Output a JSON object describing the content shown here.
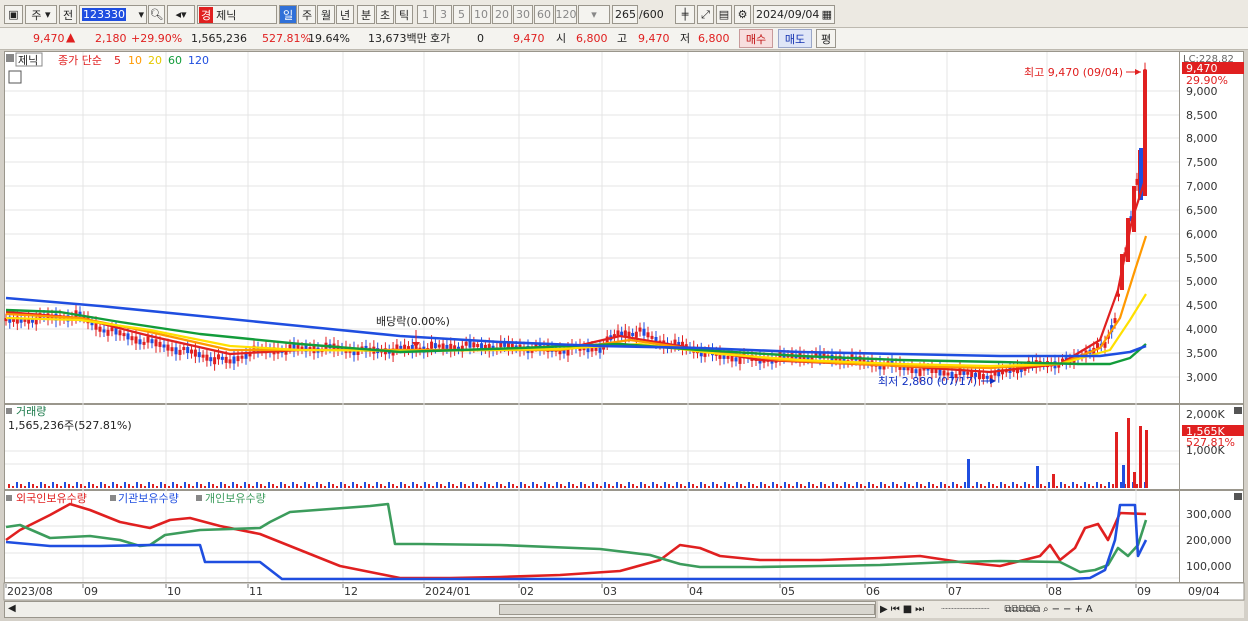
{
  "toolbar": {
    "market": "주",
    "kind": "전",
    "code": "123330",
    "badge": "경",
    "name": "제닉",
    "periods": [
      "일",
      "주",
      "월",
      "년",
      "분",
      "초",
      "틱"
    ],
    "intervals": [
      "1",
      "3",
      "5",
      "10",
      "20",
      "30",
      "60",
      "120"
    ],
    "count": "265",
    "count_max": "/600",
    "date": "2024/09/04"
  },
  "quote": {
    "price": "9,470",
    "change": "2,180",
    "rate": "+29.90%",
    "volume": "1,565,236",
    "vol_ratio": "527.81%",
    "turnover": "19.64%",
    "amount": "13,673백만",
    "hoga_label": "호가",
    "hoga": "0",
    "hoga_price": "9,470",
    "open_label": "시",
    "open": "6,800",
    "high_label": "고",
    "high": "9,470",
    "low_label": "저",
    "low": "6,800",
    "buy": "매수",
    "sell": "매도",
    "avg": "평"
  },
  "price_panel": {
    "stock_tag": "제닉",
    "legend_label": "종가 단순",
    "ma_periods": [
      "5",
      "10",
      "20",
      "60",
      "120"
    ],
    "high_annotation": "최고 9,470 (09/04)",
    "low_annotation": "최저 2,880 (07/17)",
    "dividend_annotation": "배당락(0.00%)",
    "axis_top": "LC:228.82",
    "price_badge": "9,470",
    "rate_badge": "29.90%",
    "y_labels": [
      "9,000",
      "8,500",
      "8,000",
      "7,500",
      "7,000",
      "6,500",
      "6,000",
      "5,500",
      "5,000",
      "4,500",
      "4,000",
      "3,500",
      "3,000"
    ]
  },
  "volume_panel": {
    "title": "거래량",
    "value": "1,565,236주(527.81%)",
    "y_labels": [
      "2,000K",
      "1,000K"
    ],
    "badge": "1,565K",
    "badge_rate": "527.81%"
  },
  "holding_panel": {
    "series": [
      "외국인보유수량",
      "기관보유수량",
      "개인보유수량"
    ],
    "y_labels": [
      "300,000",
      "200,000",
      "100,000"
    ]
  },
  "x_labels": [
    "2023/08",
    "09",
    "10",
    "11",
    "12",
    "2024/01",
    "02",
    "03",
    "04",
    "05",
    "06",
    "07",
    "08",
    "09"
  ],
  "x_end": "09/04",
  "colors": {
    "ma5": "#e02020",
    "ma10": "#ff9900",
    "ma20": "#ffe000",
    "ma60": "#129c3a",
    "ma120": "#1f4ee0",
    "foreign": "#e02020",
    "institution": "#1f4ee0",
    "individual": "#3c9c5c"
  }
}
